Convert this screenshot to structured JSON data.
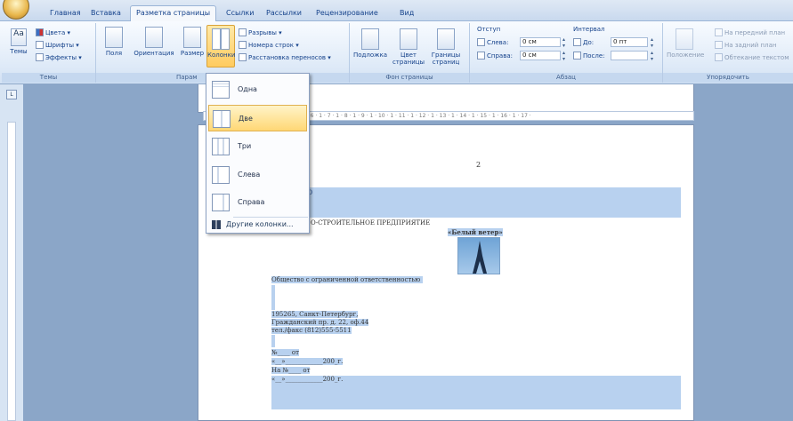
{
  "tabs": [
    "Главная",
    "Вставка",
    "Разметка страницы",
    "Ссылки",
    "Рассылки",
    "Рецензирование",
    "Вид"
  ],
  "ribbon": {
    "themes": {
      "label": "Темы",
      "big": "Темы",
      "colors": "Цвета",
      "fonts": "Шрифты",
      "effects": "Эффекты"
    },
    "page_setup": {
      "label": "Парам",
      "fields": "Поля",
      "orientation": "Ориентация",
      "size": "Размер",
      "columns": "Колонки",
      "breaks": "Разрывы",
      "line_numbers": "Номера строк",
      "hyphenation": "Расстановка переносов"
    },
    "page_background": {
      "label": "Фон страницы",
      "watermark": "Подложка",
      "color_1": "Цвет",
      "color_2": "страницы",
      "borders_1": "Границы",
      "borders_2": "страниц"
    },
    "paragraph": {
      "label": "Абзац",
      "indent": "Отступ",
      "spacing": "Интервал",
      "left": "Слева:",
      "right": "Справа:",
      "before": "До:",
      "after": "После:",
      "left_val": "0 см",
      "right_val": "0 см",
      "before_val": "0 пт",
      "after_val": ""
    },
    "arrange": {
      "label": "Упорядочить",
      "position": "Положение",
      "front": "На передний план",
      "back": "На задний план",
      "wrap": "Обтекание текстом"
    }
  },
  "ruler": "· 1 · 2 · 1 · 3 · 1 · 4 · 1 · 5 · 1 · 6 · 1 · 7 · 1 · 8 · 1 · 9 · 1 · 10 · 1 · 11 · 1 · 12 · 1 · 13 · 1 · 14 · 1 · 15 · 1 · 16 · 1 · 17 ·",
  "columns_menu": {
    "items": [
      "Одна",
      "Две",
      "Три",
      "Слева",
      "Справа"
    ],
    "selected": "Две",
    "more": "Другие колонки..."
  },
  "document": {
    "page_number": "2",
    "heading_fragment": "р",
    "company_line": "О-СТРОИТЕЛЬНОЕ ПРЕДПРИЯТИЕ",
    "brand": "«Белый ветер»",
    "company_type": "Общество с ограниченной ответственностью",
    "address_1": "195265, Санкт-Петербург,",
    "address_2": "Гражданский пр. д. 22, оф.44",
    "phone": "тел./факс (812)555-5511",
    "ref_1": "№____ от",
    "ref_2": "«__»____________200_г.",
    "ref_3": "На №____ от",
    "ref_4": "«__»____________200_г."
  },
  "colors": {
    "ribbon_bg": "#e3edf9",
    "selected": "#ffcb5f",
    "workspace": "#8ba6c8",
    "highlight": "#b8d1ef"
  }
}
